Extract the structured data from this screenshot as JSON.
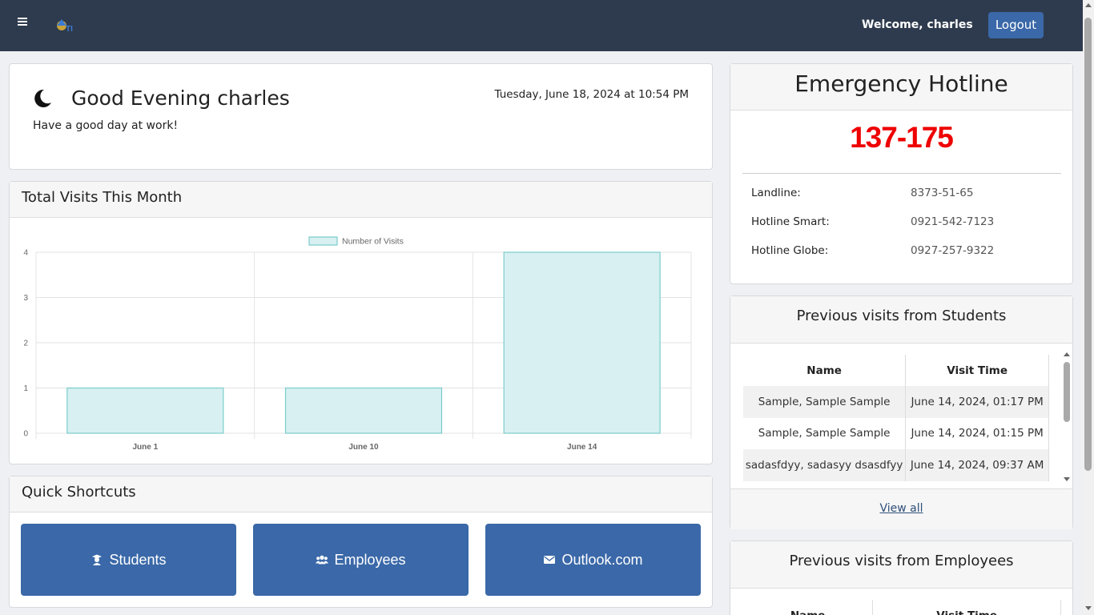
{
  "topbar": {
    "welcome": "Welcome, charles",
    "logout_label": "Logout",
    "bg_color": "#2e3b4e"
  },
  "greeting": {
    "icon": "moon-icon",
    "title": "Good Evening charles",
    "subtitle": "Have a good day at work!",
    "datetime": "Tuesday, June 18, 2024 at 10:54 PM"
  },
  "visits": {
    "title": "Total Visits This Month"
  },
  "chart_data": {
    "type": "bar",
    "categories": [
      "June 1",
      "June 10",
      "June 14"
    ],
    "series": [
      {
        "name": "Number of Visits",
        "values": [
          1,
          1,
          4
        ]
      }
    ],
    "ylim": [
      0,
      4
    ],
    "yticks": [
      0,
      1,
      2,
      3,
      4
    ],
    "grid": true,
    "legend": "top-center",
    "bar_fill": "#d8f0f1",
    "bar_stroke": "#7ccccc"
  },
  "shortcuts": {
    "title": "Quick Shortcuts",
    "buttons": [
      {
        "label": "Students",
        "icon": "student-icon"
      },
      {
        "label": "Employees",
        "icon": "users-icon"
      },
      {
        "label": "Outlook.com",
        "icon": "envelope-icon"
      }
    ],
    "color": "#3a68a8"
  },
  "hotline": {
    "title": "Emergency Hotline",
    "number": "137-175",
    "number_color": "#ee0000",
    "rows": [
      {
        "label": "Landline:",
        "value": "8373-51-65"
      },
      {
        "label": "Hotline Smart:",
        "value": "0921-542-7123"
      },
      {
        "label": "Hotline Globe:",
        "value": "0927-257-9322"
      }
    ]
  },
  "prev_students": {
    "title": "Previous visits from Students",
    "columns": [
      "Name",
      "Visit Time"
    ],
    "rows": [
      {
        "name": "Sample, Sample Sample",
        "time": "June 14, 2024, 01:17 PM"
      },
      {
        "name": "Sample, Sample Sample",
        "time": "June 14, 2024, 01:15 PM"
      },
      {
        "name": "sadasfdyy, sadasyy dsasdfyy",
        "time": "June 14, 2024, 09:37 AM"
      }
    ],
    "view_all": "View all"
  },
  "prev_employees": {
    "title": "Previous visits from Employees",
    "columns": [
      "Name",
      "Visit Time"
    ]
  }
}
